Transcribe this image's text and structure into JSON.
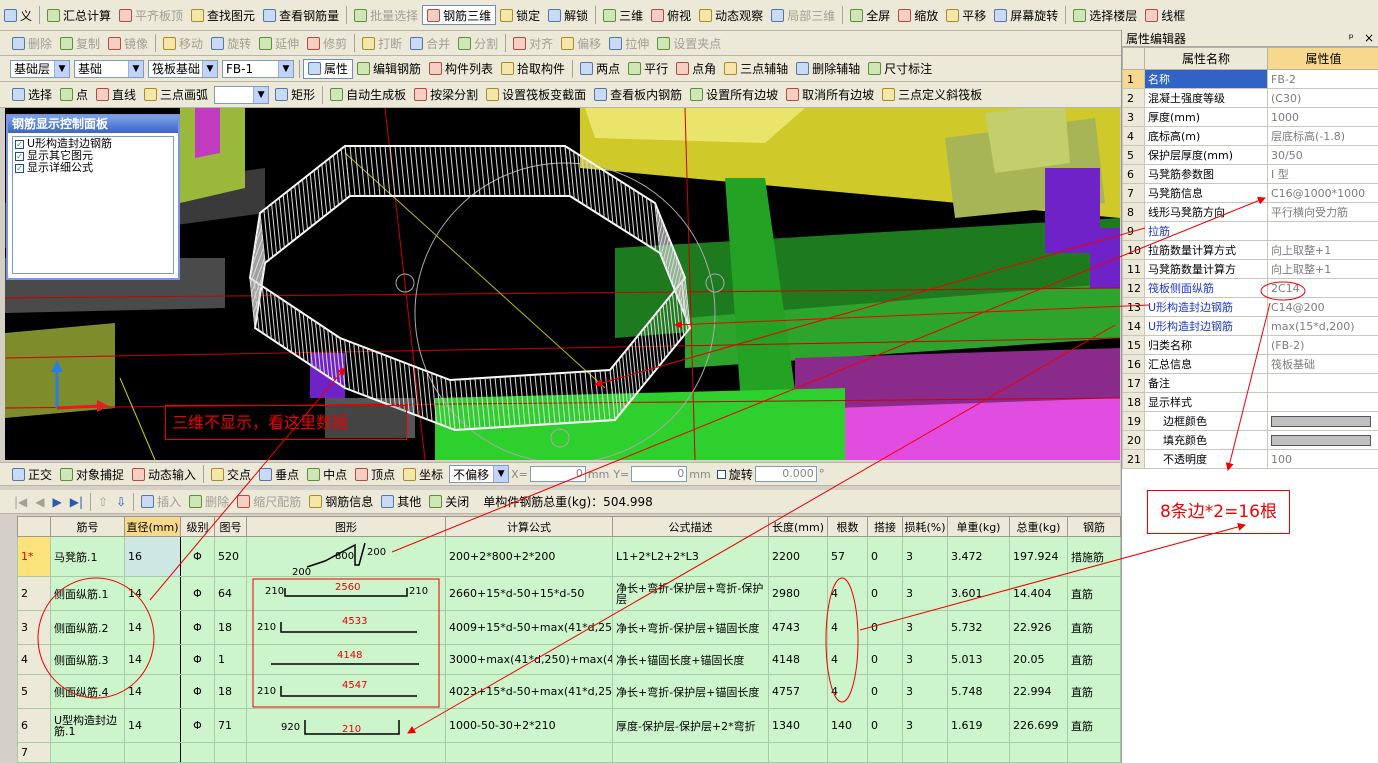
{
  "toolbar1": [
    "义",
    "汇总计算",
    "平齐板顶",
    "查找图元",
    "查看钢筋量",
    "批量选择",
    "钢筋三维",
    "锁定",
    "解锁",
    "三维",
    "俯视",
    "动态观察",
    "局部三维",
    "全屏",
    "缩放",
    "平移",
    "屏幕旋转",
    "选择楼层",
    "线框"
  ],
  "toolbar2": [
    "删除",
    "复制",
    "镜像",
    "移动",
    "旋转",
    "延伸",
    "修剪",
    "打断",
    "合并",
    "分割",
    "对齐",
    "偏移",
    "拉伸",
    "设置夹点"
  ],
  "toolbar3": {
    "floor": "基础层",
    "category": "基础",
    "type": "筏板基础",
    "element": "FB-1",
    "buttons": [
      "属性",
      "编辑钢筋",
      "构件列表",
      "拾取构件",
      "两点",
      "平行",
      "点角",
      "三点辅轴",
      "删除辅轴",
      "尺寸标注"
    ]
  },
  "toolbar4": [
    "选择",
    "点",
    "直线",
    "三点画弧",
    "矩形",
    "自动生成板",
    "按梁分割",
    "设置筏板变截面",
    "查看板内钢筋",
    "设置所有边坡",
    "取消所有边坡",
    "三点定义斜筏板"
  ],
  "control_panel": {
    "title": "钢筋显示控制面板",
    "items": [
      "U形构造封边钢筋",
      "显示其它图元",
      "显示详细公式"
    ]
  },
  "note_3d": "三维不显示，看这里数据",
  "snapbar": {
    "buttons": [
      "正交",
      "对象捕捉",
      "动态输入",
      "交点",
      "垂点",
      "中点",
      "顶点",
      "坐标"
    ],
    "offset_mode": "不偏移",
    "x_label": "X=",
    "x_value": "0",
    "mm1": "mm",
    "y_label": "Y=",
    "y_value": "0",
    "mm2": "mm",
    "rotate_label": "旋转",
    "rotate_value": "0.000",
    "deg": "°"
  },
  "grid_toolbar": {
    "buttons": [
      "插入",
      "删除",
      "缩尺配筋",
      "钢筋信息",
      "其他",
      "关闭"
    ],
    "total_label": "单构件钢筋总重(kg)：504.998"
  },
  "grid": {
    "headers": [
      "",
      "筋号",
      "直径(mm)",
      "级别",
      "图号",
      "图形",
      "计算公式",
      "公式描述",
      "长度(mm)",
      "根数",
      "搭接",
      "损耗(%)",
      "单重(kg)",
      "总重(kg)",
      "钢筋"
    ],
    "rows": [
      {
        "no": "1*",
        "name": "马凳筋.1",
        "dia": "16",
        "grade": "Φ",
        "fig": "520",
        "f": [
          "200",
          "800",
          "200"
        ],
        "formula": "200+2*800+2*200",
        "desc": "L1+2*L2+2*L3",
        "len": "2200",
        "count": "57",
        "lap": "0",
        "loss": "3",
        "unit": "3.472",
        "total": "197.924",
        "kind": "措施筋"
      },
      {
        "no": "2",
        "name": "侧面纵筋.1",
        "dia": "14",
        "grade": "Φ",
        "fig": "64",
        "f": [
          "210",
          "2560",
          "210"
        ],
        "formula": "2660+15*d-50+15*d-50",
        "desc": "净长+弯折-保护层+弯折-保护层",
        "len": "2980",
        "count": "4",
        "lap": "0",
        "loss": "3",
        "unit": "3.601",
        "total": "14.404",
        "kind": "直筋"
      },
      {
        "no": "3",
        "name": "侧面纵筋.2",
        "dia": "14",
        "grade": "Φ",
        "fig": "18",
        "f": [
          "210",
          "4533"
        ],
        "formula": "4009+15*d-50+max(41*d,250)",
        "desc": "净长+弯折-保护层+锚固长度",
        "len": "4743",
        "count": "4",
        "lap": "0",
        "loss": "3",
        "unit": "5.732",
        "total": "22.926",
        "kind": "直筋"
      },
      {
        "no": "4",
        "name": "侧面纵筋.3",
        "dia": "14",
        "grade": "Φ",
        "fig": "1",
        "f": [
          "4148"
        ],
        "formula": "3000+max(41*d,250)+max(41*d,250)",
        "desc": "净长+锚固长度+锚固长度",
        "len": "4148",
        "count": "4",
        "lap": "0",
        "loss": "3",
        "unit": "5.013",
        "total": "20.05",
        "kind": "直筋"
      },
      {
        "no": "5",
        "name": "侧面纵筋.4",
        "dia": "14",
        "grade": "Φ",
        "fig": "18",
        "f": [
          "210",
          "4547"
        ],
        "formula": "4023+15*d-50+max(41*d,250)",
        "desc": "净长+弯折-保护层+锚固长度",
        "len": "4757",
        "count": "4",
        "lap": "0",
        "loss": "3",
        "unit": "5.748",
        "total": "22.994",
        "kind": "直筋"
      },
      {
        "no": "6",
        "name": "U型构造封边筋.1",
        "dia": "14",
        "grade": "Φ",
        "fig": "71",
        "f": [
          "920",
          "210"
        ],
        "formula": "1000-50-30+2*210",
        "desc": "厚度-保护层-保护层+2*弯折",
        "len": "1340",
        "count": "140",
        "lap": "0",
        "loss": "3",
        "unit": "1.619",
        "total": "226.699",
        "kind": "直筋"
      },
      {
        "no": "7",
        "name": "",
        "dia": "",
        "grade": "",
        "fig": "",
        "f": [],
        "formula": "",
        "desc": "",
        "len": "",
        "count": "",
        "lap": "",
        "loss": "",
        "unit": "",
        "total": "",
        "kind": ""
      }
    ]
  },
  "props": {
    "title": "属性编辑器",
    "pin": "ᵖ",
    "close": "×",
    "h_name": "属性名称",
    "h_val": "属性值",
    "rows": [
      [
        "1",
        "名称",
        "FB-2"
      ],
      [
        "2",
        "混凝土强度等级",
        "(C30)"
      ],
      [
        "3",
        "厚度(mm)",
        "1000"
      ],
      [
        "4",
        "底标高(m)",
        "层底标高(-1.8)"
      ],
      [
        "5",
        "保护层厚度(mm)",
        "30/50"
      ],
      [
        "6",
        "马凳筋参数图",
        "I 型"
      ],
      [
        "7",
        "马凳筋信息",
        "C16@1000*1000"
      ],
      [
        "8",
        "线形马凳筋方向",
        "平行横向受力筋"
      ],
      [
        "9",
        "拉筋",
        ""
      ],
      [
        "10",
        "拉筋数量计算方式",
        "向上取整+1"
      ],
      [
        "11",
        "马凳筋数量计算方",
        "向上取整+1"
      ],
      [
        "12",
        "筏板侧面纵筋",
        "2C14"
      ],
      [
        "13",
        "U形构造封边钢筋",
        "C14@200"
      ],
      [
        "14",
        "U形构造封边钢筋",
        "max(15*d,200)"
      ],
      [
        "15",
        "归类名称",
        "(FB-2)"
      ],
      [
        "16",
        "汇总信息",
        "筏板基础"
      ],
      [
        "17",
        "备注",
        ""
      ],
      [
        "18",
        "显示样式",
        ""
      ],
      [
        "19",
        "边框颜色",
        ""
      ],
      [
        "20",
        "填充颜色",
        ""
      ],
      [
        "21",
        "不透明度",
        "100"
      ]
    ]
  },
  "annotation": "8条边*2=16根",
  "colors": {
    "red": "#e00000",
    "accent": "#f7d98d",
    "grid_bg": "#ccf5cc",
    "blue_link": "#1f37c8"
  }
}
